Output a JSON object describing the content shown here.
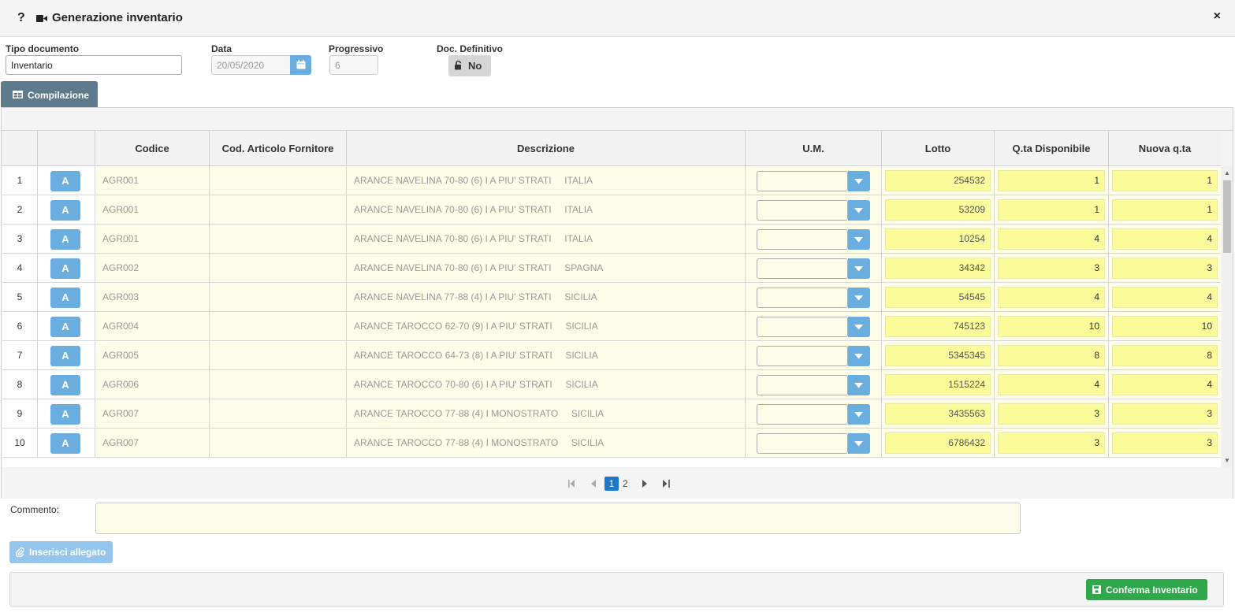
{
  "window": {
    "help_icon": "?",
    "title": "Generazione inventario",
    "close_icon": "×"
  },
  "form": {
    "tipo_label": "Tipo documento",
    "tipo_value": "Inventario",
    "data_label": "Data",
    "data_value": "20/05/2020",
    "progressivo_label": "Progressivo",
    "progressivo_value": "6",
    "definitivo_label": "Doc. Definitivo",
    "definitivo_value": "No"
  },
  "tab": {
    "label": "Compilazione"
  },
  "table": {
    "headers": [
      "Codice",
      "Cod. Articolo Fornitore",
      "Descrizione",
      "U.M.",
      "Lotto",
      "Q.ta Disponibile",
      "Nuova q.ta"
    ],
    "rows": [
      {
        "n": "1",
        "btn": "A",
        "codice": "AGR001",
        "descr": "ARANCE NAVELINA 70-80 (6) I A PIU' STRATI     ITALIA",
        "lotto": "254532",
        "disp": "1",
        "nuova": "1"
      },
      {
        "n": "2",
        "btn": "A",
        "codice": "AGR001",
        "descr": "ARANCE NAVELINA 70-80 (6) I A PIU' STRATI     ITALIA",
        "lotto": "53209",
        "disp": "1",
        "nuova": "1"
      },
      {
        "n": "3",
        "btn": "A",
        "codice": "AGR001",
        "descr": "ARANCE NAVELINA 70-80 (6) I A PIU' STRATI     ITALIA",
        "lotto": "10254",
        "disp": "4",
        "nuova": "4"
      },
      {
        "n": "4",
        "btn": "A",
        "codice": "AGR002",
        "descr": "ARANCE NAVELINA 70-80 (6) I A PIU' STRATI     SPAGNA",
        "lotto": "34342",
        "disp": "3",
        "nuova": "3"
      },
      {
        "n": "5",
        "btn": "A",
        "codice": "AGR003",
        "descr": "ARANCE NAVELINA 77-88 (4) I A PIU' STRATI     SICILIA",
        "lotto": "54545",
        "disp": "4",
        "nuova": "4"
      },
      {
        "n": "6",
        "btn": "A",
        "codice": "AGR004",
        "descr": "ARANCE TAROCCO 62-70 (9) I A PIU' STRATI     SICILIA",
        "lotto": "745123",
        "disp": "10",
        "nuova": "10"
      },
      {
        "n": "7",
        "btn": "A",
        "codice": "AGR005",
        "descr": "ARANCE TAROCCO 64-73 (8) I A PIU' STRATI     SICILIA",
        "lotto": "5345345",
        "disp": "8",
        "nuova": "8"
      },
      {
        "n": "8",
        "btn": "A",
        "codice": "AGR006",
        "descr": "ARANCE TAROCCO 70-80 (6) I A PIU' STRATI     SICILIA",
        "lotto": "1515224",
        "disp": "4",
        "nuova": "4"
      },
      {
        "n": "9",
        "btn": "A",
        "codice": "AGR007",
        "descr": "ARANCE TAROCCO 77-88 (4) I MONOSTRATO     SICILIA",
        "lotto": "3435563",
        "disp": "3",
        "nuova": "3"
      },
      {
        "n": "10",
        "btn": "A",
        "codice": "AGR007",
        "descr": "ARANCE TAROCCO 77-88 (4) I MONOSTRATO     SICILIA",
        "lotto": "6786432",
        "disp": "3",
        "nuova": "3"
      }
    ]
  },
  "pager": {
    "current": "1",
    "next_page": "2"
  },
  "comment": {
    "label": "Commento:"
  },
  "buttons": {
    "attach": "Inserisci allegato",
    "confirm": "Conferma Inventario"
  },
  "colors": {
    "accent_blue": "#6aaee0",
    "tab_bg": "#5d7b8c",
    "row_bg": "#fdfde8",
    "qty_yellow": "#fbfb9a",
    "confirm_green": "#2ea84a"
  }
}
